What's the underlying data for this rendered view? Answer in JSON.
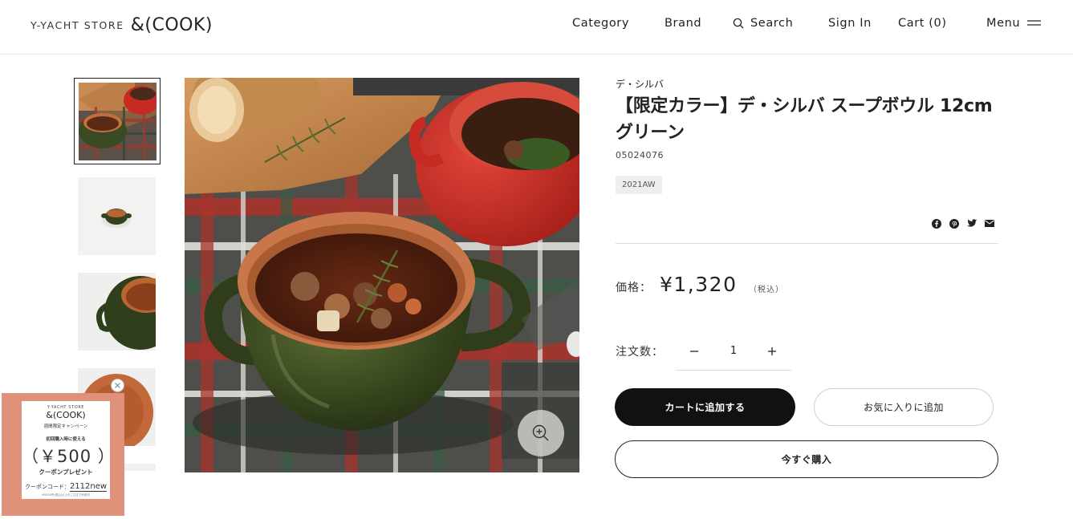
{
  "header": {
    "logo_small": "Y-YACHT STORE",
    "logo_big": "&(COOK)",
    "nav": {
      "category": "Category",
      "brand": "Brand",
      "search": "Search",
      "sign_in": "Sign In",
      "cart": "Cart (0)",
      "menu": "Menu"
    }
  },
  "gallery": {
    "thumbnail_count_visible": 5,
    "active_thumbnail": 1
  },
  "product": {
    "brand": "デ・シルバ",
    "title_line1": "【限定カラー】デ・シルバ スープボウル 12cm",
    "title_line2": "グリーン",
    "code": "05024076",
    "season_tag": "2021AW",
    "price_label": "価格：",
    "price": "¥1,320",
    "tax_note": "（税込）",
    "quantity_label": "注文数：",
    "quantity": "1"
  },
  "actions": {
    "add_to_cart": "カートに追加する",
    "add_to_favorites": "お気に入りに追加",
    "buy_now": "今すぐ購入"
  },
  "share_icons": [
    "facebook-icon",
    "pinterest-icon",
    "twitter-icon",
    "mail-icon"
  ],
  "coupon": {
    "store": "Y-YACHT STORE",
    "logo": "&(COOK)",
    "campaign": "週間限定キャンペーン",
    "line_first_purchase": "初回購入時に使える",
    "amount": "（￥500 ）",
    "present": "クーポンプレゼント",
    "code_label": "クーポンコード：",
    "code": "2112new",
    "note": "※5000円(税込)以上のご注文で利用可"
  },
  "colors": {
    "primary_button": "#111111",
    "coupon_bg": "#e0917a",
    "bowl_green": "#3a4a22",
    "bowl_red": "#c62a22"
  }
}
